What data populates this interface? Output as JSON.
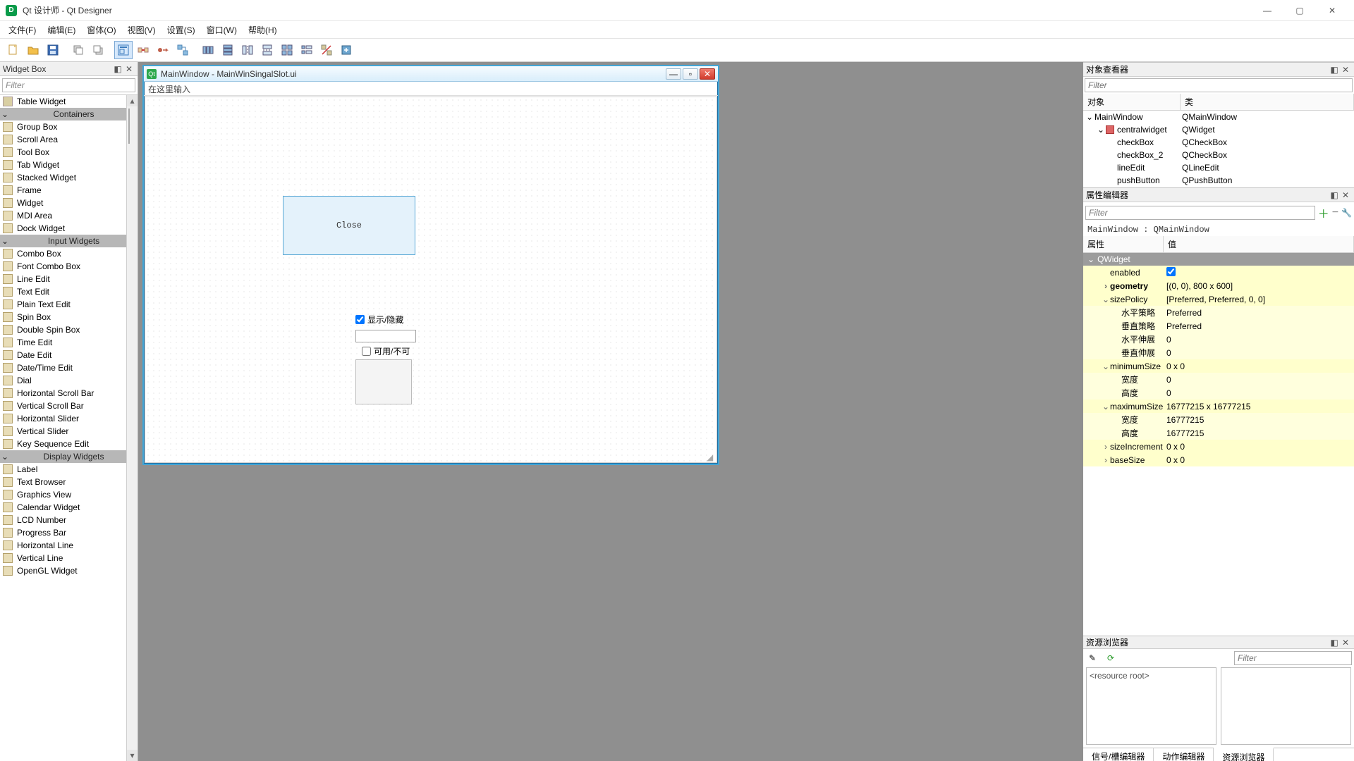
{
  "app": {
    "title": "Qt 设计师 - Qt Designer"
  },
  "menu": {
    "file": "文件(F)",
    "edit": "编辑(E)",
    "form": "窗体(O)",
    "view": "视图(V)",
    "settings": "设置(S)",
    "window": "窗口(W)",
    "help": "帮助(H)"
  },
  "left": {
    "title": "Widget Box",
    "filter_placeholder": "Filter",
    "partial_top_item": "Table Widget",
    "categories": {
      "containers": {
        "label": "Containers",
        "items": [
          "Group Box",
          "Scroll Area",
          "Tool Box",
          "Tab Widget",
          "Stacked Widget",
          "Frame",
          "Widget",
          "MDI Area",
          "Dock Widget"
        ]
      },
      "input": {
        "label": "Input Widgets",
        "items": [
          "Combo Box",
          "Font Combo Box",
          "Line Edit",
          "Text Edit",
          "Plain Text Edit",
          "Spin Box",
          "Double Spin Box",
          "Time Edit",
          "Date Edit",
          "Date/Time Edit",
          "Dial",
          "Horizontal Scroll Bar",
          "Vertical Scroll Bar",
          "Horizontal Slider",
          "Vertical Slider",
          "Key Sequence Edit"
        ]
      },
      "display": {
        "label": "Display Widgets",
        "items": [
          "Label",
          "Text Browser",
          "Graphics View",
          "Calendar Widget",
          "LCD Number",
          "Progress Bar",
          "Horizontal Line",
          "Vertical Line",
          "OpenGL Widget"
        ]
      }
    }
  },
  "form": {
    "title": "MainWindow - MainWinSingalSlot.ui",
    "inner_menu": "在这里输入",
    "close_btn": "Close",
    "cb_show_hide": "显示/隐藏",
    "cb_enable": "可用/不可"
  },
  "objects": {
    "title": "对象查看器",
    "filter_placeholder": "Filter",
    "cols": {
      "obj": "对象",
      "cls": "类"
    },
    "rows": [
      {
        "n": "MainWindow",
        "c": "QMainWindow",
        "d": 0,
        "exp": "v"
      },
      {
        "n": "centralwidget",
        "c": "QWidget",
        "d": 1,
        "exp": "v",
        "icon": "layout"
      },
      {
        "n": "checkBox",
        "c": "QCheckBox",
        "d": 2
      },
      {
        "n": "checkBox_2",
        "c": "QCheckBox",
        "d": 2
      },
      {
        "n": "lineEdit",
        "c": "QLineEdit",
        "d": 2
      },
      {
        "n": "pushButton",
        "c": "QPushButton",
        "d": 2
      }
    ]
  },
  "props": {
    "title": "属性编辑器",
    "filter_placeholder": "Filter",
    "context": "MainWindow : QMainWindow",
    "cols": {
      "name": "属性",
      "value": "值"
    },
    "group": "QWidget",
    "items": [
      {
        "k": "enabled",
        "v": "",
        "check": true,
        "exp": ""
      },
      {
        "k": "geometry",
        "v": "[(0, 0), 800 x 600]",
        "exp": ">",
        "bold": true
      },
      {
        "k": "sizePolicy",
        "v": "[Preferred, Preferred, 0, 0]",
        "exp": "v"
      },
      {
        "k": "水平策略",
        "v": "Preferred",
        "ind": 2
      },
      {
        "k": "垂直策略",
        "v": "Preferred",
        "ind": 2
      },
      {
        "k": "水平伸展",
        "v": "0",
        "ind": 2
      },
      {
        "k": "垂直伸展",
        "v": "0",
        "ind": 2
      },
      {
        "k": "minimumSize",
        "v": "0 x 0",
        "exp": "v"
      },
      {
        "k": "宽度",
        "v": "0",
        "ind": 2
      },
      {
        "k": "高度",
        "v": "0",
        "ind": 2
      },
      {
        "k": "maximumSize",
        "v": "16777215 x 16777215",
        "exp": "v"
      },
      {
        "k": "宽度",
        "v": "16777215",
        "ind": 2
      },
      {
        "k": "高度",
        "v": "16777215",
        "ind": 2
      },
      {
        "k": "sizeIncrement",
        "v": "0 x 0",
        "exp": ">"
      },
      {
        "k": "baseSize",
        "v": "0 x 0",
        "exp": ">"
      }
    ]
  },
  "resources": {
    "title": "资源浏览器",
    "root": "<resource root>",
    "filter_placeholder": "Filter"
  },
  "tabs": {
    "signals": "信号/槽编辑器",
    "actions": "动作编辑器",
    "resources": "资源浏览器"
  }
}
